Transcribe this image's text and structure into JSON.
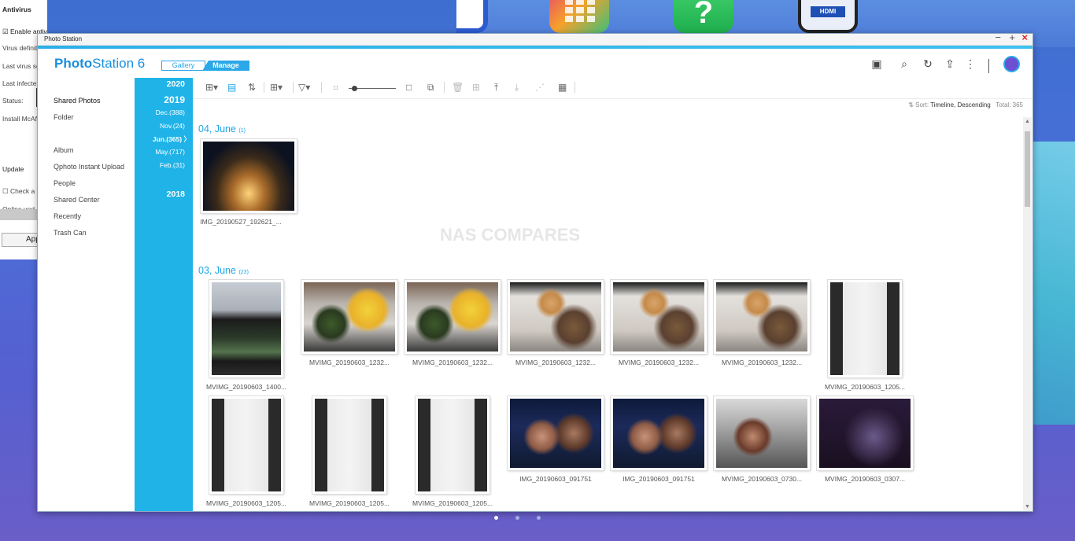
{
  "antivirus": {
    "heading": "Antivirus",
    "enable": "Enable antivirus",
    "virus_def": "Virus definit",
    "last_scan": "Last virus sc",
    "last_infected": "Last infecte",
    "status": "Status:",
    "install": "Install McAf",
    "update": "Update",
    "check": "Check a",
    "online": "Online upd",
    "apply": "App"
  },
  "window": {
    "title": "Photo Station",
    "minimize": "−",
    "maximize": "+",
    "close": "×"
  },
  "app": {
    "logo_bold": "Photo",
    "logo_rest": "Station 6",
    "mode_gallery": "Gallery",
    "mode_manage": "Manage"
  },
  "nav": {
    "shared_photos": "Shared Photos",
    "folder": "Folder",
    "album": "Album",
    "qphoto": "Qphoto Instant Upload",
    "people": "People",
    "shared_center": "Shared Center",
    "recently": "Recently",
    "trash": "Trash Can"
  },
  "timeline": {
    "y2020": "2020",
    "y2019": "2019",
    "dec": "Dec.(388)",
    "nov": "Nov.(24)",
    "jun": "Jun.(365) 〉",
    "may": "May.(717)",
    "feb": "Feb.(31)",
    "y2018": "2018"
  },
  "sort": {
    "label": "Sort:",
    "value": "Timeline, Descending",
    "total": "Total: 365"
  },
  "groups": {
    "g1_date": "04, June",
    "g1_count": "(1)",
    "g2_date": "03, June",
    "g2_count": "(23)"
  },
  "captions": {
    "c1": "IMG_20190527_192621_...",
    "c2": "MVIMG_20190603_1400...",
    "c3": "MVIMG_20190603_1232...",
    "c4": "MVIMG_20190603_1232...",
    "c5": "MVIMG_20190603_1232...",
    "c6": "MVIMG_20190603_1232...",
    "c7": "MVIMG_20190603_1232...",
    "c8": "MVIMG_20190603_1205...",
    "c9": "MVIMG_20190603_1205...",
    "c10": "MVIMG_20190603_1205...",
    "c11": "MVIMG_20190603_1205...",
    "c12": "IMG_20190603_091751",
    "c13": "IMG_20190603_091751",
    "c14": "MVIMG_20190603_0730...",
    "c15": "MVIMG_20190603_0307..."
  },
  "watermark": "NAS COMPARES",
  "dock": {
    "help": "?",
    "hdmi": "HDMI"
  },
  "icons": {
    "search": "search-icon",
    "refresh": "refresh-icon",
    "upload": "upload-icon",
    "more": "more-icon",
    "media": "media-viewer-icon"
  }
}
